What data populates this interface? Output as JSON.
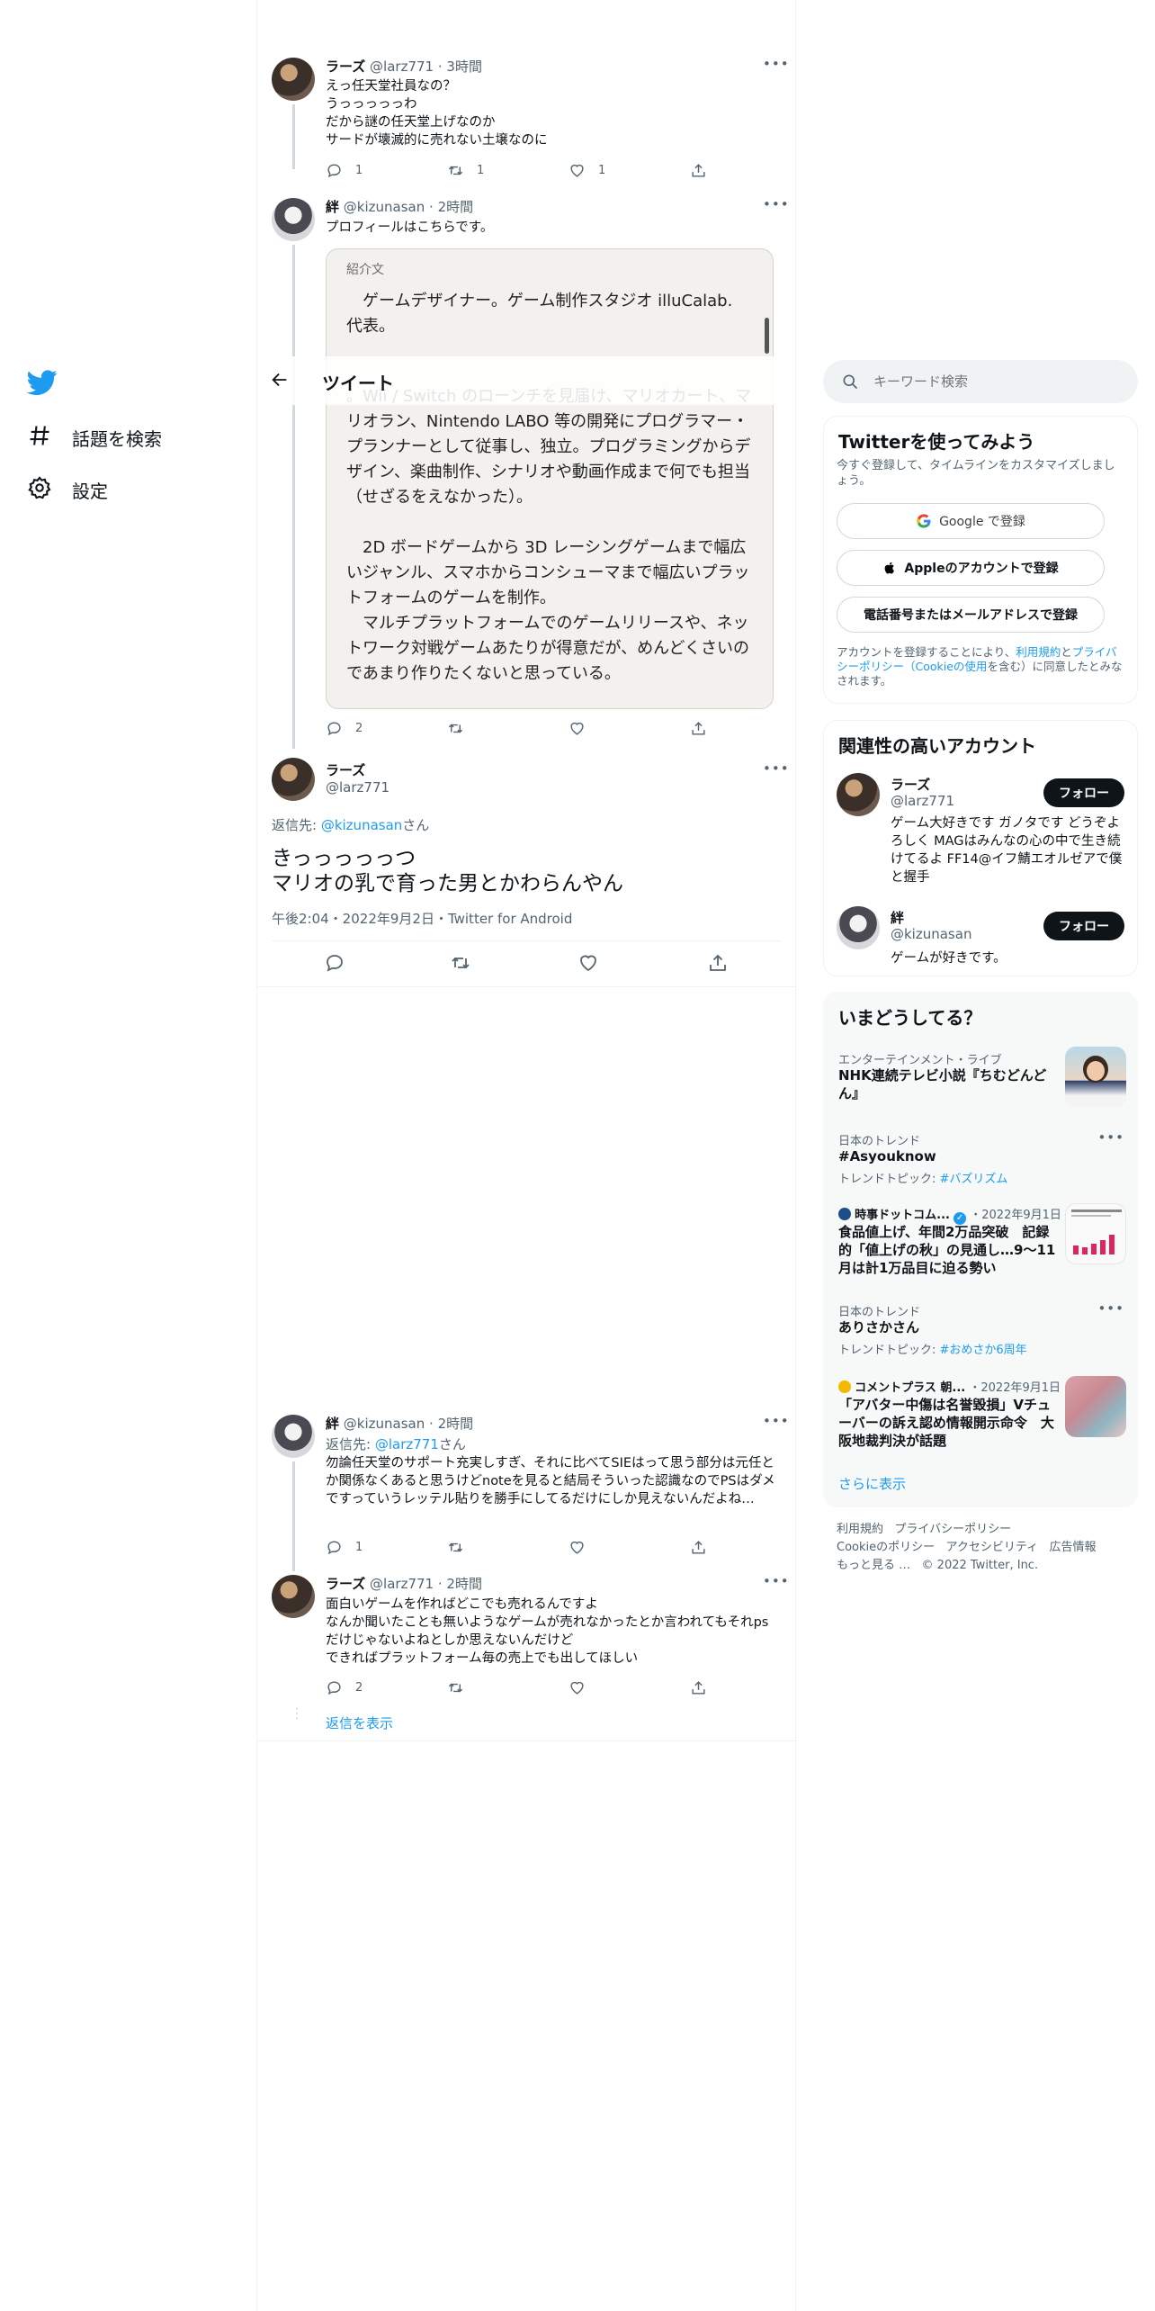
{
  "sidebar": {
    "items": [
      {
        "label": "話題を検索",
        "icon": "hashtag-icon"
      },
      {
        "label": "設定",
        "icon": "gear-icon"
      }
    ]
  },
  "header": {
    "title": "ツイート"
  },
  "tweets": {
    "t1": {
      "name": "ラーズ",
      "handle": "@larz771",
      "time": "3時間",
      "lines": [
        "えっ任天堂社員なの？",
        "うっっっっっわ",
        "だから謎の任天堂上げなのか",
        "サードが壊滅的に売れない土壌なのに"
      ],
      "replies": "1",
      "retweets": "1",
      "likes": "1"
    },
    "t2": {
      "name": "絆",
      "handle": "@kizunasan",
      "time": "2時間",
      "text": "プロフィールはこちらです。",
      "card_label": "紹介文",
      "card_p1": "ゲームデザイナー。ゲーム制作スタジオ illuCalab. 代表。",
      "card_p2": "。Wii / Switch のローンチを見届け、マリオカート、マリオラン、Nintendo LABO 等の開発にプログラマー・プランナーとして従事し、独立。プログラミングからデザイン、楽曲制作、シナリオや動画作成まで何でも担当（せざるをえなかった）。",
      "card_p3": "2D ボードゲームから 3D レーシングゲームまで幅広いジャンル、スマホからコンシューマまで幅広いプラットフォームのゲームを制作。",
      "card_p4": "マルチプラットフォームでのゲームリリースや、ネットワーク対戦ゲームあたりが得意だが、めんどくさいのであまり作りたくないと思っている。",
      "replies": "2"
    },
    "main": {
      "name": "ラーズ",
      "handle": "@larz771",
      "reply_prefix": "返信先: ",
      "reply_to": "@kizunasan",
      "reply_suffix": "さん",
      "line1": "きっっっっっつ",
      "line2": "マリオの乳で育った男とかわらんやん",
      "meta": "午後2:04・2022年9月2日・Twitter for Android"
    },
    "t3": {
      "name": "絆",
      "handle": "@kizunasan",
      "time": "2時間",
      "reply_prefix": "返信先: ",
      "reply_to": "@larz771",
      "reply_suffix": "さん",
      "text": "勿論任天堂のサポート充実しすぎ、それに比べてSIEはって思う部分は元任とか関係なくあると思うけどnoteを見ると結局そういった認識なのでPSはダメですっていうレッテル貼りを勝手にしてるだけにしか見えないんだよね…",
      "replies": "1"
    },
    "t4": {
      "name": "ラーズ",
      "handle": "@larz771",
      "time": "2時間",
      "lines": [
        "面白いゲームを作ればどこでも売れるんですよ",
        "なんか聞いたことも無いようなゲームが売れなかったとか言われてもそれpsだけじゃないよねとしか思えないんだけど",
        "できればプラットフォーム毎の売上でも出してほしい"
      ],
      "replies": "2"
    },
    "show_replies": "返信を表示"
  },
  "search": {
    "placeholder": "キーワード検索"
  },
  "signup": {
    "title": "Twitterを使ってみよう",
    "desc": "今すぐ登録して、タイムラインをカスタマイズしましょう。",
    "google": "Google で登録",
    "apple": "Appleのアカウントで登録",
    "phone": "電話番号またはメールアドレスで登録",
    "legal_1": "アカウントを登録することにより、",
    "legal_terms": "利用規約",
    "legal_and": "と",
    "legal_privacy": "プライバシーポリシー（Cookieの使用",
    "legal_2": "を含む）に同意したとみなされます。"
  },
  "related": {
    "title": "関連性の高いアカウント",
    "accounts": [
      {
        "name": "ラーズ",
        "handle": "@larz771",
        "bio": "ゲーム大好きです ガノタです どうぞよろしく MAGはみんなの心の中で生き続けてるよ FF14@イフ鯖エオルゼアで僕と握手",
        "follow": "フォロー"
      },
      {
        "name": "絆",
        "handle": "@kizunasan",
        "bio": "ゲームが好きです。",
        "follow": "フォロー"
      }
    ]
  },
  "trends": {
    "title": "いまどうしてる？",
    "items": [
      {
        "context": "エンターテインメント・ライブ",
        "title": "NHK連続テレビ小説『ちむどんどん』"
      },
      {
        "context": "日本のトレンド",
        "title": "#Asyouknow",
        "topic_prefix": "トレンドトピック: ",
        "topic": "#バズリズム"
      },
      {
        "source": "時事ドットコム...",
        "date": "・2022年9月1日",
        "title": "食品値上げ、年間2万品突破　記録的「値上げの秋」の見通し…9～11月は計1万品目に迫る勢い"
      },
      {
        "context": "日本のトレンド",
        "title": "ありさかさん",
        "topic_prefix": "トレンドトピック: ",
        "topic": "#おめさか6周年"
      },
      {
        "source": "コメントプラス 朝...",
        "date": "・2022年9月1日",
        "title": "「アバター中傷は名誉毀損」Vチューバーの訴え認め情報開示命令　大阪地裁判決が話題"
      }
    ],
    "more": "さらに表示"
  },
  "footer": {
    "line1": [
      "利用規約",
      "プライバシーポリシー"
    ],
    "line2": [
      "Cookieのポリシー",
      "アクセシビリティ",
      "広告情報"
    ],
    "line3": [
      "もっと見る …",
      "© 2022 Twitter, Inc."
    ]
  },
  "colors": {
    "accent": "#1d9bf0",
    "text": "#0f1419",
    "muted": "#536471"
  }
}
